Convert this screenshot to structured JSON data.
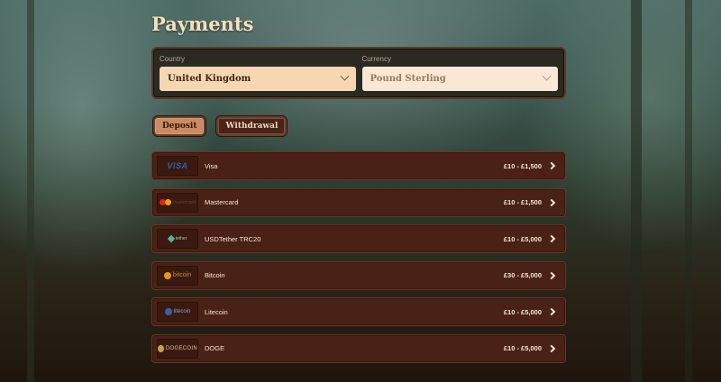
{
  "page": {
    "title": "Payments"
  },
  "selectors": {
    "country_label": "Country",
    "country_value": "United Kingdom",
    "currency_label": "Currency",
    "currency_value": "Pound Sterling"
  },
  "tabs": [
    {
      "label": "Deposit",
      "active": true
    },
    {
      "label": "Withdrawal",
      "active": false
    }
  ],
  "methods": [
    {
      "name": "Visa",
      "range": "£10 - £1,500",
      "logo": "visa-logo",
      "logo_text": "VISA"
    },
    {
      "name": "Mastercard",
      "range": "£10 - £1,500",
      "logo": "mastercard-logo",
      "logo_text": "mastercard"
    },
    {
      "name": "USDTether TRC20",
      "range": "£10 - £5,000",
      "logo": "tether-logo",
      "logo_text": "tether"
    },
    {
      "name": "Bitcoin",
      "range": "£30 - £5,000",
      "logo": "bitcoin-logo",
      "logo_text": "bitcoin"
    },
    {
      "name": "Litecoin",
      "range": "£10 - £5,000",
      "logo": "litecoin-logo",
      "logo_text": "litecoin"
    },
    {
      "name": "DOGE",
      "range": "£10 - £5,000",
      "logo": "dogecoin-logo",
      "logo_text": "DOGECOIN"
    }
  ],
  "colors": {
    "panel_bg": "#2a2a22",
    "row_bg": "#4a2116",
    "title": "#f6dfb9",
    "tab_active": "#c98a66"
  }
}
